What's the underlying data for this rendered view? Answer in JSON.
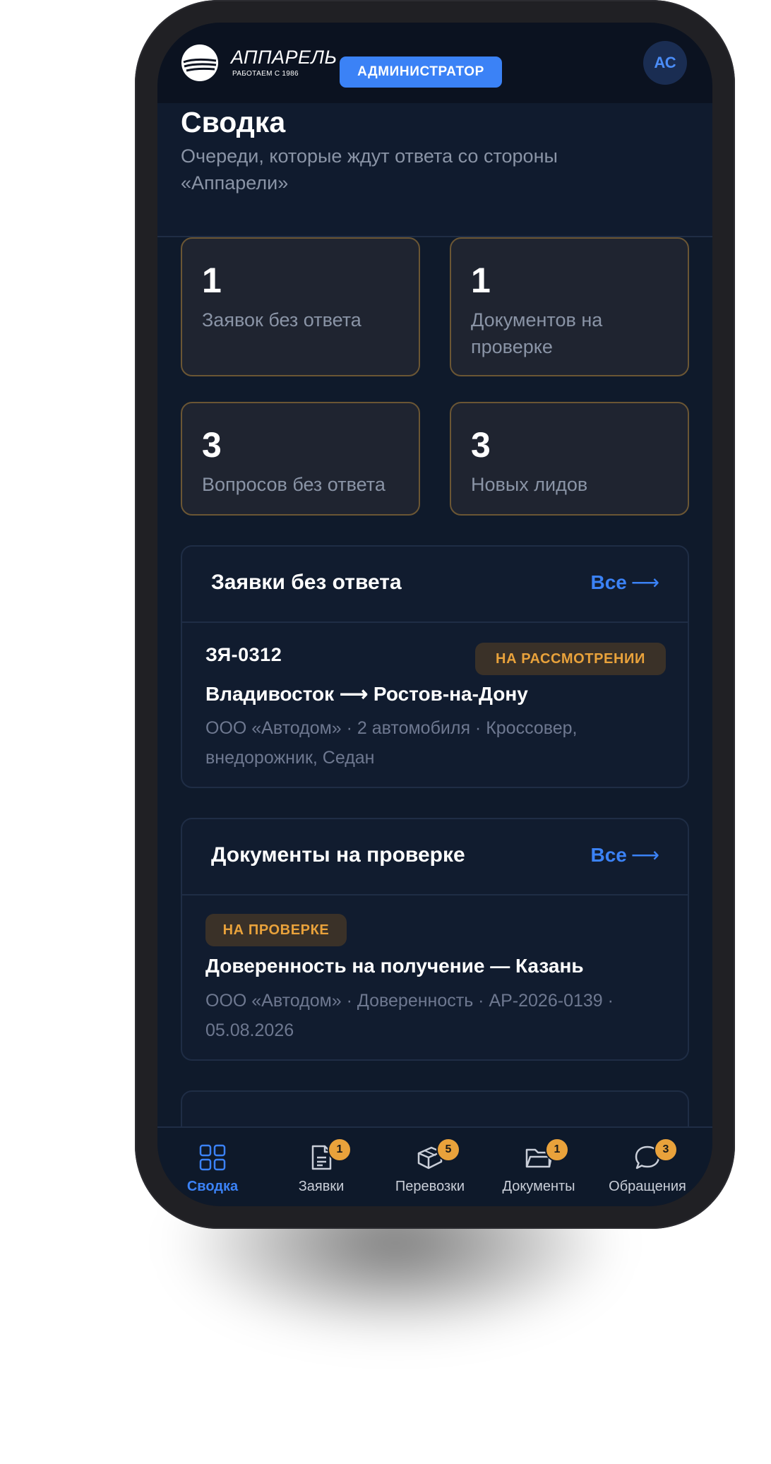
{
  "header": {
    "logo_title": "АППАРЕЛЬ",
    "logo_subtitle": "РАБОТАЕМ С 1986",
    "role": "АДМИНИСТРАТОР",
    "avatar_initials": "АС"
  },
  "page": {
    "title": "Сводка",
    "subtitle": "Очереди, которые ждут ответа со стороны «Аппарели»"
  },
  "stats": [
    {
      "value": "1",
      "label": "Заявок без ответа"
    },
    {
      "value": "1",
      "label": "Документов на проверке"
    },
    {
      "value": "3",
      "label": "Вопросов без ответа"
    },
    {
      "value": "3",
      "label": "Новых лидов"
    }
  ],
  "sections": {
    "requests": {
      "title": "Заявки без ответа",
      "link": "Все",
      "link_arrow": "⟶",
      "item": {
        "id": "ЗЯ-0312",
        "status": "НА РАССМОТРЕНИИ",
        "route": "Владивосток ⟶ Ростов-на-Дону",
        "meta": "ООО «Автодом» · 2 автомобиля · Кроссовер, внедорожник, Седан"
      }
    },
    "documents": {
      "title": "Документы на проверке",
      "link": "Все",
      "link_arrow": "⟶",
      "item": {
        "status": "НА ПРОВЕРКЕ",
        "title": "Доверенность на получение — Казань",
        "meta": "ООО «Автодом» · Доверенность · АР-2026-0139 · 05.08.2026"
      }
    }
  },
  "nav": [
    {
      "label": "Сводка",
      "icon": "grid-icon",
      "badge": "",
      "active": true
    },
    {
      "label": "Заявки",
      "icon": "document-icon",
      "badge": "1"
    },
    {
      "label": "Перевозки",
      "icon": "package-icon",
      "badge": "5"
    },
    {
      "label": "Документы",
      "icon": "folder-icon",
      "badge": "1"
    },
    {
      "label": "Обращения",
      "icon": "chat-bubble-icon",
      "badge": "3"
    }
  ],
  "colors": {
    "accent": "#3b82f6",
    "warning": "#e9a23b",
    "background": "#0f1a2b"
  }
}
